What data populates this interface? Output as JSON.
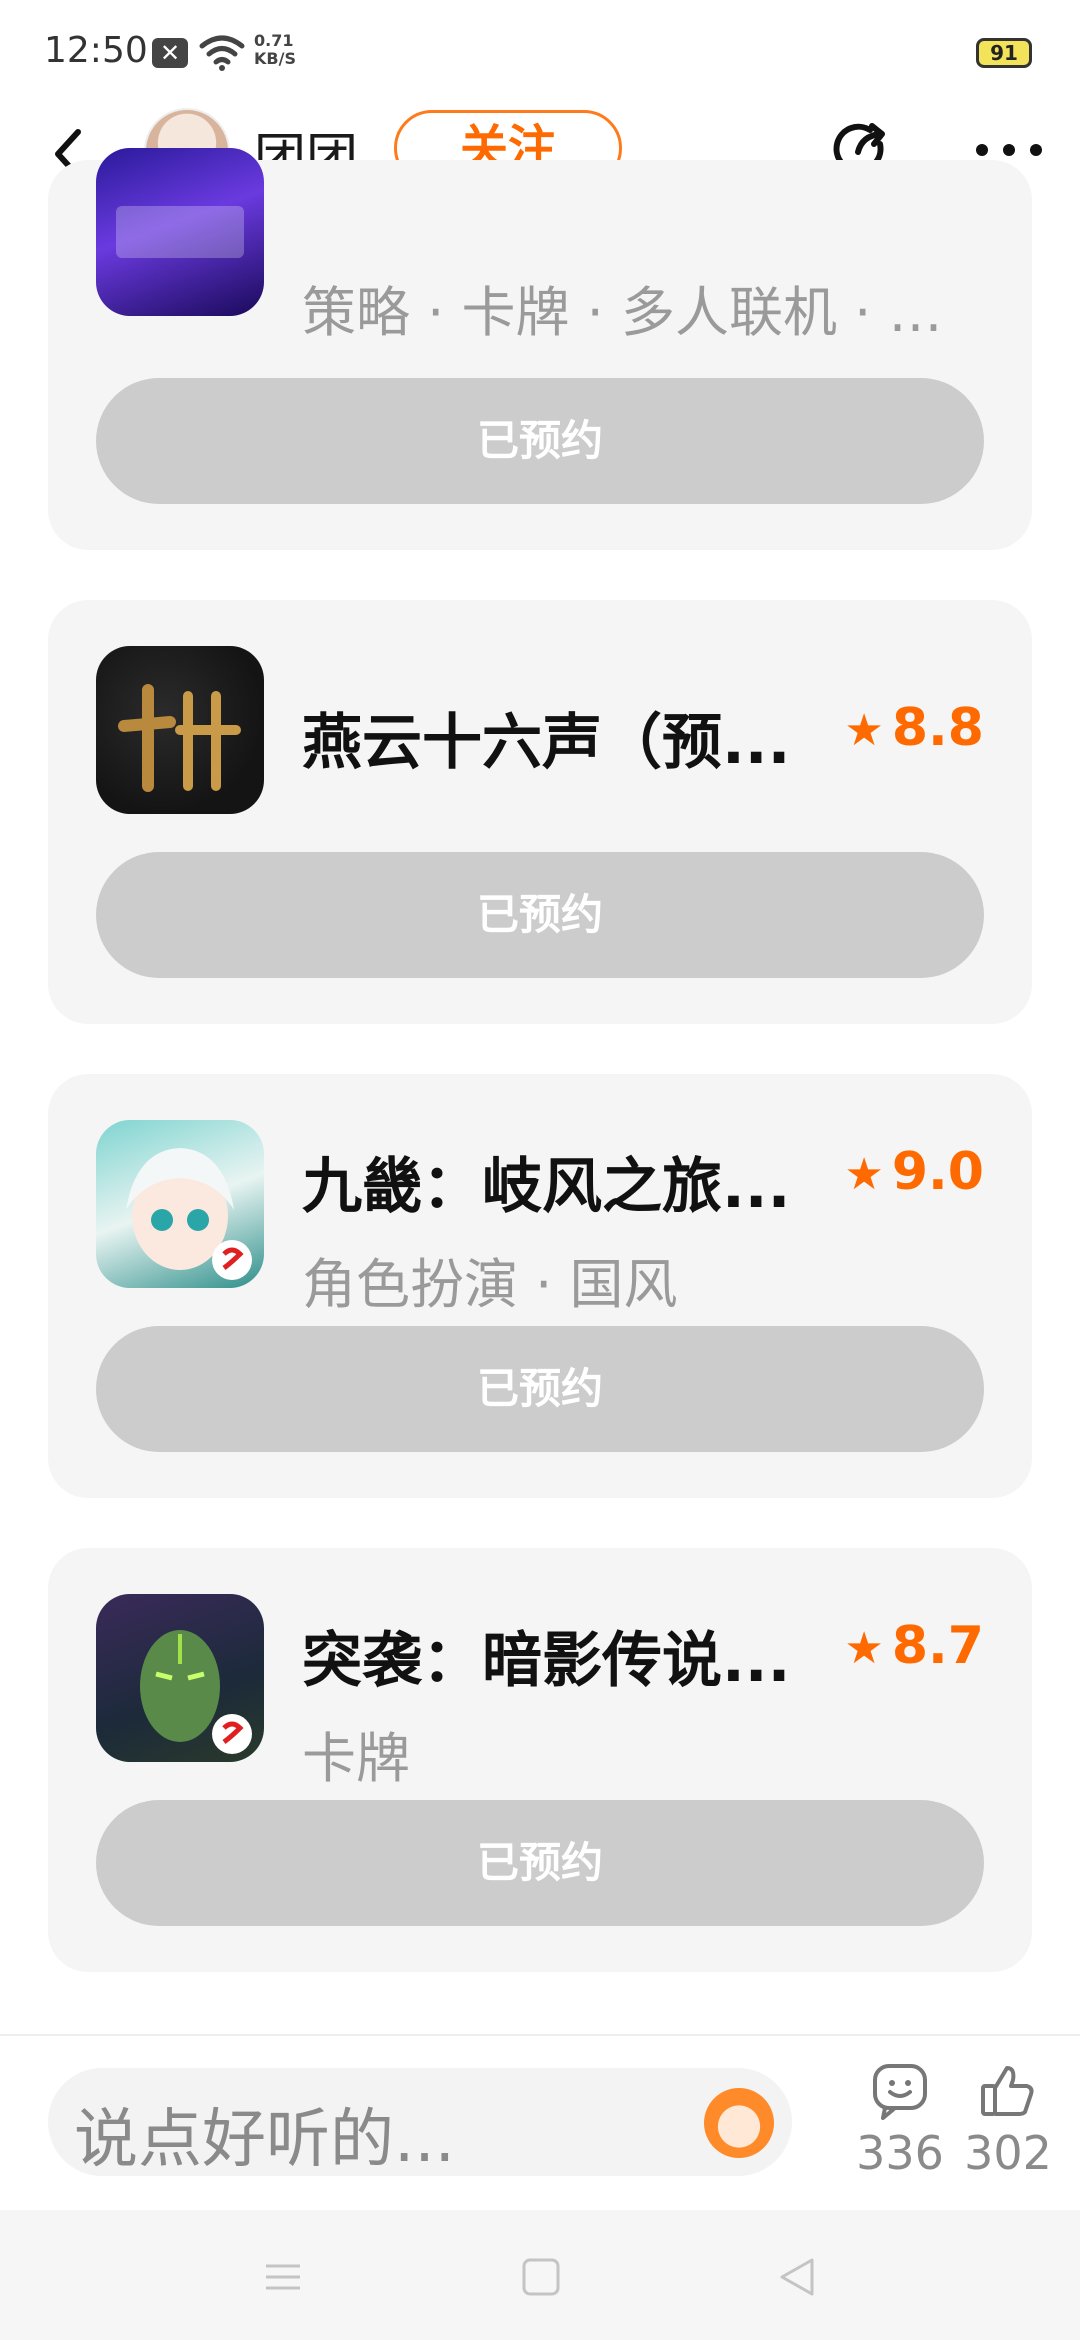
{
  "status_bar": {
    "time": "12:50",
    "notification_glyph": "✕",
    "net_speed_value": "0.71",
    "net_speed_unit": "KB/S",
    "battery": "91"
  },
  "header": {
    "username": "团团",
    "follow_label": "关注"
  },
  "games": [
    {
      "title": "",
      "rating": "",
      "tags": "策略 · 卡牌 · 多人联机 · …",
      "button": "已预约",
      "icon": "game-icon-partial"
    },
    {
      "title": "燕云十六声（预...",
      "rating": "8.8",
      "tags": "",
      "button": "已预约",
      "icon": "game-icon-yanyun"
    },
    {
      "title": "九畿：岐风之旅...",
      "rating": "9.0",
      "tags": "角色扮演 · 国风",
      "button": "已预约",
      "icon": "game-icon-jiuji"
    },
    {
      "title": "突袭：暗影传说...",
      "rating": "8.7",
      "tags": "卡牌",
      "button": "已预约",
      "icon": "game-icon-tuxi"
    }
  ],
  "bottom_bar": {
    "comment_placeholder": "说点好听的...",
    "comments_count": "336",
    "likes_count": "302"
  },
  "colors": {
    "accent": "#ff6a00",
    "card_bg": "#f5f5f5",
    "button_disabled": "#cccccc"
  }
}
